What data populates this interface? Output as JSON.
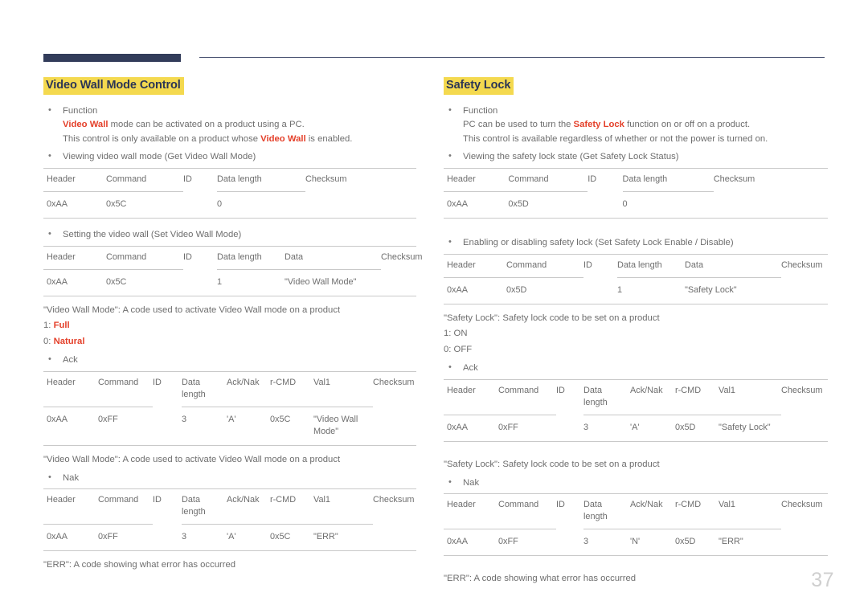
{
  "page": {
    "number": "37",
    "accent_navy": "#323c5a",
    "accent_highlight": "#f4d94f",
    "accent_red": "#e4402a",
    "rule_color": "#c9c9c9"
  },
  "columns": {
    "left": {
      "title": "Video Wall Mode Control",
      "function_bullet": {
        "label": "Function",
        "line2_pre": "",
        "line2_red": "Video Wall",
        "line2_post": " mode can be activated on a product using a PC.",
        "line3_pre": "This control is only available on a product whose ",
        "line3_red": "Video Wall",
        "line3_post": " is enabled."
      },
      "get_bullet": "Viewing video wall mode (Get Video Wall Mode)",
      "get_table": {
        "headers": [
          "Header",
          "Command",
          "ID",
          "Data length",
          "Checksum"
        ],
        "row": [
          "0xAA",
          "0x5C",
          "",
          "0",
          ""
        ]
      },
      "set_bullet": "Setting the video wall (Set Video Wall Mode)",
      "set_table": {
        "headers": [
          "Header",
          "Command",
          "ID",
          "Data length",
          "Data",
          "Checksum"
        ],
        "row": [
          "0xAA",
          "0x5C",
          "",
          "1",
          "\"Video Wall Mode\"",
          ""
        ]
      },
      "note_code": "\"Video Wall Mode\": A code used to activate Video Wall mode on a product",
      "code_values": [
        {
          "key": "1: ",
          "value": "Full"
        },
        {
          "key": "0: ",
          "value": "Natural"
        }
      ],
      "ack_bullet": "Ack",
      "ack_table": {
        "headers": [
          "Header",
          "Command",
          "ID",
          "Data length",
          "Ack/Nak",
          "r-CMD",
          "Val1",
          "Checksum"
        ],
        "row": [
          "0xAA",
          "0xFF",
          "",
          "3",
          "'A'",
          "0x5C",
          "\"Video Wall Mode\"",
          ""
        ]
      },
      "ack_note": "\"Video Wall Mode\": A code used to activate Video Wall mode on a product",
      "nak_bullet": "Nak",
      "nak_table": {
        "headers": [
          "Header",
          "Command",
          "ID",
          "Data length",
          "Ack/Nak",
          "r-CMD",
          "Val1",
          "Checksum"
        ],
        "row": [
          "0xAA",
          "0xFF",
          "",
          "3",
          "'A'",
          "0x5C",
          "\"ERR\"",
          ""
        ]
      },
      "nak_note": "\"ERR\": A code showing what error has occurred"
    },
    "right": {
      "title": "Safety Lock",
      "function_bullet": {
        "label": "Function",
        "line2_pre": "PC can be used to turn the ",
        "line2_red": "Safety Lock",
        "line2_post": " function on or off on a product.",
        "line3": "This control is available regardless of whether or not the power is turned on."
      },
      "get_bullet": "Viewing the safety lock state (Get Safety Lock Status)",
      "get_table": {
        "headers": [
          "Header",
          "Command",
          "ID",
          "Data length",
          "Checksum"
        ],
        "row": [
          "0xAA",
          "0x5D",
          "",
          "0",
          ""
        ]
      },
      "set_bullet": "Enabling or disabling safety lock (Set Safety Lock Enable / Disable)",
      "set_table": {
        "headers": [
          "Header",
          "Command",
          "ID",
          "Data length",
          "Data",
          "Checksum"
        ],
        "row": [
          "0xAA",
          "0x5D",
          "",
          "1",
          "\"Safety Lock\"",
          ""
        ]
      },
      "note_code": "\"Safety Lock\": Safety lock code to be set on a product",
      "code_values": [
        {
          "text": "1: ON"
        },
        {
          "text": "0: OFF"
        }
      ],
      "ack_bullet": "Ack",
      "ack_table": {
        "headers": [
          "Header",
          "Command",
          "ID",
          "Data length",
          "Ack/Nak",
          "r-CMD",
          "Val1",
          "Checksum"
        ],
        "row": [
          "0xAA",
          "0xFF",
          "",
          "3",
          "'A'",
          "0x5D",
          "\"Safety Lock\"",
          ""
        ]
      },
      "ack_note": "\"Safety Lock\": Safety lock code to be set on a product",
      "nak_bullet": "Nak",
      "nak_table": {
        "headers": [
          "Header",
          "Command",
          "ID",
          "Data length",
          "Ack/Nak",
          "r-CMD",
          "Val1",
          "Checksum"
        ],
        "row": [
          "0xAA",
          "0xFF",
          "",
          "3",
          "'N'",
          "0x5D",
          "\"ERR\"",
          ""
        ]
      },
      "nak_note": "\"ERR\": A code showing what error has occurred"
    }
  }
}
